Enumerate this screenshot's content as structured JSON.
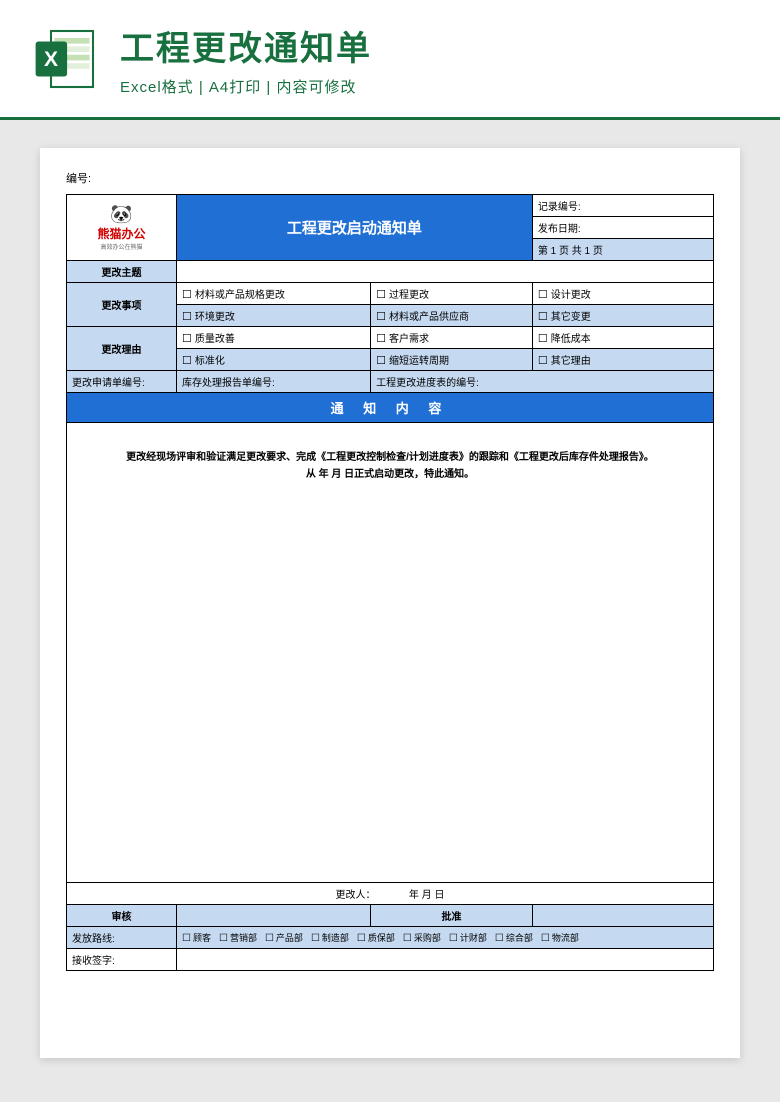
{
  "header": {
    "title": "工程更改通知单",
    "subtitle": "Excel格式 | A4打印 | 内容可修改"
  },
  "doc": {
    "number_label": "编号:",
    "form_title": "工程更改启动通知单",
    "record_no_label": "记录编号:",
    "issue_date_label": "发布日期:",
    "page_info": "第 1 页   共 1 页",
    "logo_brand": "熊猫办公",
    "logo_slogan": "高效办公在熊猫",
    "subject_label": "更改主题",
    "items_label": "更改事项",
    "reason_label": "更改理由",
    "items": {
      "r1c1": "材料或产品规格更改",
      "r1c2": "过程更改",
      "r1c3": "设计更改",
      "r2c1": "环境更改",
      "r2c2": "材料或产品供应商",
      "r2c3": "其它变更"
    },
    "reasons": {
      "r1c1": "质量改善",
      "r1c2": "客户需求",
      "r1c3": "降低成本",
      "r2c1": "标准化",
      "r2c2": "缩短运转周期",
      "r2c3": "其它理由"
    },
    "apply_no_label": "更改申请单编号:",
    "stock_report_label": "库存处理报告单编号:",
    "progress_label": "工程更改进度表的编号:",
    "notice_header": "通 知 内 容",
    "content_line1": "更改经现场评审和验证满足更改要求、完成《工程更改控制检查/计划进度表》的跟踪和《工程更改后库存件处理报告》。",
    "content_line2": "从   年   月   日正式启动更改，特此通知。",
    "changer_label": "更改人：",
    "date_template": "年   月   日",
    "audit_label": "审核",
    "approve_label": "批准",
    "route_label": "发放路线:",
    "departments": [
      "顾客",
      "营销部",
      "产品部",
      "制造部",
      "质保部",
      "采购部",
      "计财部",
      "综合部",
      "物流部"
    ],
    "receive_label": "接收签字:"
  }
}
